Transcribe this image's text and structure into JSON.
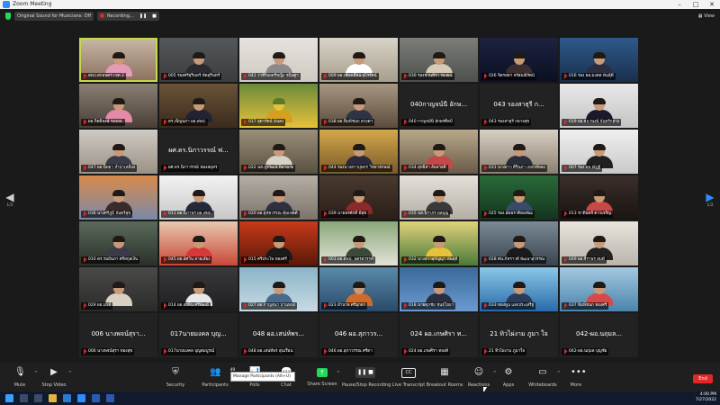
{
  "window": {
    "title": "Zoom Meeting",
    "view_label": "View"
  },
  "infobar": {
    "audio_label": "Original Sound for Musicians: Off",
    "recording_label": "Recording...",
    "pause_glyph": "❚❚",
    "stop_glyph": "■"
  },
  "pager": {
    "prev_glyph": "◀",
    "next_glyph": "▶",
    "prev_page": "1/2",
    "next_page": "1/2"
  },
  "gallery": {
    "tiles": [
      {
        "type": "video",
        "name": "สพป.สกลนคร เขต 2",
        "c1": "#c8b8a6",
        "c2": "#8a6f5c",
        "shirt": "#e59ab8",
        "active": true
      },
      {
        "type": "video",
        "name": "005 รองศรีสุรินทร์ หัดสุรินทร์",
        "c1": "#55585a",
        "c2": "#3a3d40",
        "shirt": "#2a2a32"
      },
      {
        "type": "video",
        "name": "041 ว่าที่ร้อยตรีหญิง ชนิษฐา",
        "c1": "#e6e2dd",
        "c2": "#cfc9c2",
        "shirt": "#8a8a8a"
      },
      {
        "type": "video",
        "name": "009 ผอ.เพียงเดือน อุไรรัตน์",
        "c1": "#d9d4c8",
        "c2": "#a79e8b",
        "shirt": "#ffffff"
      },
      {
        "type": "video",
        "name": "030 รองชานพีรา รองผอ.",
        "c1": "#7a7d78",
        "c2": "#4d504b",
        "shirt": "#d8cbb6"
      },
      {
        "type": "video",
        "name": "026 จิตรลดา จรัสมณีรัตน์",
        "c1": "#1d2340",
        "c2": "#0b0f22",
        "shirt": "#3a2e2e"
      },
      {
        "type": "video",
        "name": "016 รอง ผอ.มงคล พันธุ์ดี",
        "c1": "#2d5a8a",
        "c2": "#1a2f4d",
        "shirt": "#2a2e40"
      },
      {
        "type": "video",
        "name": "ผอ.กิตติพงษ์ รองผอ.",
        "c1": "#8a7f74",
        "c2": "#4a3f38",
        "shirt": "#e48aa8"
      },
      {
        "type": "video",
        "name": "ดร.เพ็ญนภา ผอ.สพป.",
        "c1": "#6a5238",
        "c2": "#3a2b1c",
        "shirt": "#222233"
      },
      {
        "type": "video",
        "name": "017 สุดารัตน์ มั่นคง",
        "c1": "#6a8a3a",
        "c2": "#e6c23a",
        "shirt": "#d4a020",
        "skin": "#e6c23a",
        "hair": "#5a7a2a"
      },
      {
        "type": "video",
        "name": "038 ผอ.พิมพ์ชนก ดวงตา",
        "c1": "#a69682",
        "c2": "#5c4c3c",
        "shirt": "#2e3444"
      },
      {
        "type": "label",
        "big": "040กาญจน์นี อักษ...",
        "name": "040 กาญจน์นี อักษรศิลป์"
      },
      {
        "type": "label",
        "big": "043 รองสาธุรี ก...",
        "name": "043 รองสาธุรี กลางสุข"
      },
      {
        "type": "video",
        "name": "019 ผอ.ธนาพงษ์ จันทร์กลาง",
        "c1": "#e8e8e8",
        "c2": "#c4c4c4",
        "shirt": "#1a1a2a"
      },
      {
        "type": "video",
        "name": "047 ผอ.นิตยา จำปาเหลือง",
        "c1": "#cfcac2",
        "c2": "#9a9186",
        "shirt": "#3a3a48"
      },
      {
        "type": "label",
        "big": "ผศ.ดร.นิภาวรรณ์ ฟ...",
        "name": "ผศ.ดร.นิภาวรรณ์ ฟองสมุทร"
      },
      {
        "type": "video",
        "name": "022 นส.ภูรวัฒน์ พิลาฉาย",
        "c1": "#9a8f78",
        "c2": "#5a5040",
        "shirt": "#d8d2c6"
      },
      {
        "type": "video",
        "name": "044 รองนางสาวบุษกร วิทยาลักษณ์",
        "c1": "#d4a84a",
        "c2": "#7a5a2a",
        "shirt": "#2a2a3a"
      },
      {
        "type": "video",
        "name": "034 สุทธิสา ฮ้อสวัสดิ์",
        "c1": "#b8a88a",
        "c2": "#6a5a48",
        "shirt": "#c44848"
      },
      {
        "type": "video",
        "name": "031 นางสาว ศิรินภา เหล่าสีทอง",
        "c1": "#d8d0c4",
        "c2": "#8a8070",
        "shirt": "#2a2e3a"
      },
      {
        "type": "video",
        "name": "007 รอง ผอ.ณัฏฐ์",
        "c1": "#f0f0f0",
        "c2": "#c8c8c8",
        "shirt": "#202020"
      },
      {
        "type": "video",
        "name": "036 นางศรีภูมิ จันทร์สุข",
        "c1": "#d88a4a",
        "c2": "#7a8aa8",
        "shirt": "#3a2a2a"
      },
      {
        "type": "video",
        "name": "011 ผอ.นิภาพร ผอ.สพป.",
        "c1": "#f2f2f2",
        "c2": "#c8c8c8",
        "shirt": "#242a3a"
      },
      {
        "type": "video",
        "name": "020 ผอ.อุทัยวรรณ คุ้มเขตต์",
        "c1": "#b4aea4",
        "c2": "#7a746a",
        "shirt": "#2c3040"
      },
      {
        "type": "video",
        "name": "039 นายพรศักดิ์ มีสุข",
        "c1": "#4a3a30",
        "c2": "#2a1e18",
        "shirt": "#8a2a2a"
      },
      {
        "type": "video",
        "name": "035 นส.นิราภร ผลบุญ",
        "c1": "#e4e0da",
        "c2": "#b4aea4",
        "shirt": "#3a3a3a"
      },
      {
        "type": "video",
        "name": "025 รอง.อัมพร สีทองพัฒ",
        "c1": "#2a6a3a",
        "c2": "#14341e",
        "shirt": "#3a4a6a"
      },
      {
        "type": "video",
        "name": "013 ชาตินทร์ ดาวเจริญ",
        "c1": "#3a2e2a",
        "c2": "#1a1412",
        "shirt": "#c84848"
      },
      {
        "type": "video",
        "name": "010 ดร.รมย์นภา ศรีสกุลเงิน",
        "c1": "#5a6a5a",
        "c2": "#2a302a",
        "shirt": "#3a3a4a"
      },
      {
        "type": "video",
        "name": "045 ผอ.อัศวิน สายเสียง",
        "c1": "#e8c8b0",
        "c2": "#c84838",
        "shirt": "#d83838"
      },
      {
        "type": "video",
        "name": "015 ศรีประไพ ทองศรี",
        "c1": "#c83a1a",
        "c2": "#5a1808",
        "shirt": "#1a1a1a"
      },
      {
        "type": "video",
        "name": "003 ผอ.สพป. นครสวรรค์",
        "c1": "#8aa87a",
        "c2": "#e2e2d8",
        "shirt": "#3a4a3a"
      },
      {
        "type": "video",
        "name": "032 นางสาวสุกัญญา พันธุ์ดี",
        "c1": "#e0d27a",
        "c2": "#4a7a3a",
        "shirt": "#e6c23a"
      },
      {
        "type": "video",
        "name": "028 ศน.ภัทราวดี พัฒนาสุวรรณ",
        "c1": "#7a8a96",
        "c2": "#3a4450",
        "shirt": "#1a1a1a"
      },
      {
        "type": "video",
        "name": "049 ผอ.จีราพร สมดี",
        "c1": "#e8e4dc",
        "c2": "#bab4aa",
        "shirt": "#222"
      },
      {
        "type": "video",
        "name": "029 ผอ.มาลี",
        "c1": "#4a4a48",
        "c2": "#2a2a28",
        "shirt": "#d8d0c0"
      },
      {
        "type": "video",
        "name": "014 ผอ.อรพิน ศรีพัฒน์",
        "c1": "#3a3a3c",
        "c2": "#1e1e20",
        "shirt": "#e8e8e8"
      },
      {
        "type": "video",
        "name": "027 ผอ.กาญจนา ปานทอง",
        "c1": "#8ab4c8",
        "c2": "#c8dae4",
        "shirt": "#4a6a8a"
      },
      {
        "type": "video",
        "name": "023 อำนาจ ศรีมุกดา",
        "c1": "#5a8aaa",
        "c2": "#2a4a6a",
        "shirt": "#d06a2a"
      },
      {
        "type": "video",
        "name": "018 นายศุภชัย พันธ์โยธา",
        "c1": "#3a6a9a",
        "c2": "#6a9ad0",
        "shirt": "#2a2e40"
      },
      {
        "type": "video",
        "name": "033 ทองพูน แสงประเสริฐ",
        "c1": "#8ac8e8",
        "c2": "#2a6aaa",
        "shirt": "#2a3a5a"
      },
      {
        "type": "video",
        "name": "037 พิมพ์ชนก ทองศรี",
        "c1": "#a4c8e0",
        "c2": "#4a84ac",
        "shirt": "#d84848"
      },
      {
        "type": "label",
        "big": "006 นางพจน์สุรา...",
        "name": "006 นางพจน์สุรา ทองสุข"
      },
      {
        "type": "label",
        "big": "017นายมงคล บุญ...",
        "name": "017นายมงคล บุญสมบูรณ์"
      },
      {
        "type": "label",
        "big": "048 ผอ.เสน่ห์พร...",
        "name": "048 ผอ.เสน่ห์พร อุ่นเรือน"
      },
      {
        "type": "label",
        "big": "046 ผอ.สุภาวร...",
        "name": "046 ผอ.สุภาวรรณ ศรีดา"
      },
      {
        "type": "label",
        "big": "024 ผอ.เกษศิรา ท...",
        "name": "024 ผอ.เกษศิรา ทองดี"
      },
      {
        "type": "label",
        "big": "21 ทิวไผ่งาม ภูมา ใจ",
        "name": "21 ทิวไผ่งาม ภูมาใจ"
      },
      {
        "type": "label",
        "big": "042-ผอ.นฤมล...",
        "name": "042-ผอ.นฤมล บุญชัย"
      }
    ]
  },
  "toolbar": {
    "mute": "Mute",
    "stop_video": "Stop Video",
    "security": "Security",
    "participants": "Participants",
    "participants_count": "49",
    "polls": "Polls",
    "chat": "Chat",
    "share_screen": "Share Screen",
    "pause_stop_recording": "Pause/Stop Recording",
    "live_transcript": "Live Transcript",
    "breakout_rooms": "Breakout Rooms",
    "reactions": "Reactions",
    "apps": "Apps",
    "whiteboards": "Whiteboards",
    "more": "More",
    "end": "End"
  },
  "tooltip": {
    "text": "Manage Participants (Alt+U)"
  },
  "taskbar": {
    "time": "4:00 PM",
    "date": "7/27/2022"
  },
  "colors": {
    "accent": "#2d8cff",
    "active_speaker": "#c5d94a",
    "end": "#e02828",
    "share": "#23d959"
  }
}
